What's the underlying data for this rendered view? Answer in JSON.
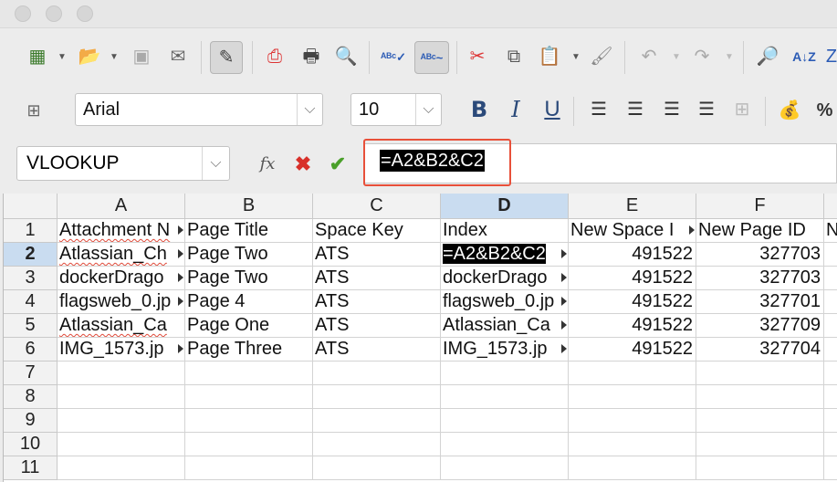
{
  "toolbar": {
    "font_name": "Arial",
    "font_size": "10"
  },
  "formula_bar": {
    "name_box": "VLOOKUP",
    "formula": "=A2&B2&C2"
  },
  "grid": {
    "columns": [
      "A",
      "B",
      "C",
      "D",
      "E",
      "F"
    ],
    "active_column": "D",
    "rows": [
      "1",
      "2",
      "3",
      "4",
      "5",
      "6",
      "7",
      "8",
      "9",
      "10",
      "11"
    ],
    "active_row": "2",
    "cells": [
      [
        "Attachment N",
        "Page Title",
        "Space Key",
        "Index",
        "New Space I",
        "New Page ID",
        "N"
      ],
      [
        "Atlassian_Ch",
        "Page Two",
        "ATS",
        "=A2&B2&C2",
        "491522",
        "327703",
        ""
      ],
      [
        "dockerDrago",
        "Page Two",
        "ATS",
        "dockerDrago",
        "491522",
        "327703",
        ""
      ],
      [
        "flagsweb_0.jp",
        "Page 4",
        "ATS",
        "flagsweb_0.jp",
        "491522",
        "327701",
        ""
      ],
      [
        "Atlassian_Ca",
        "Page One",
        "ATS",
        "Atlassian_Ca",
        "491522",
        "327709",
        ""
      ],
      [
        "IMG_1573.jp",
        "Page Three",
        "ATS",
        "IMG_1573.jp",
        "491522",
        "327704",
        ""
      ]
    ]
  }
}
